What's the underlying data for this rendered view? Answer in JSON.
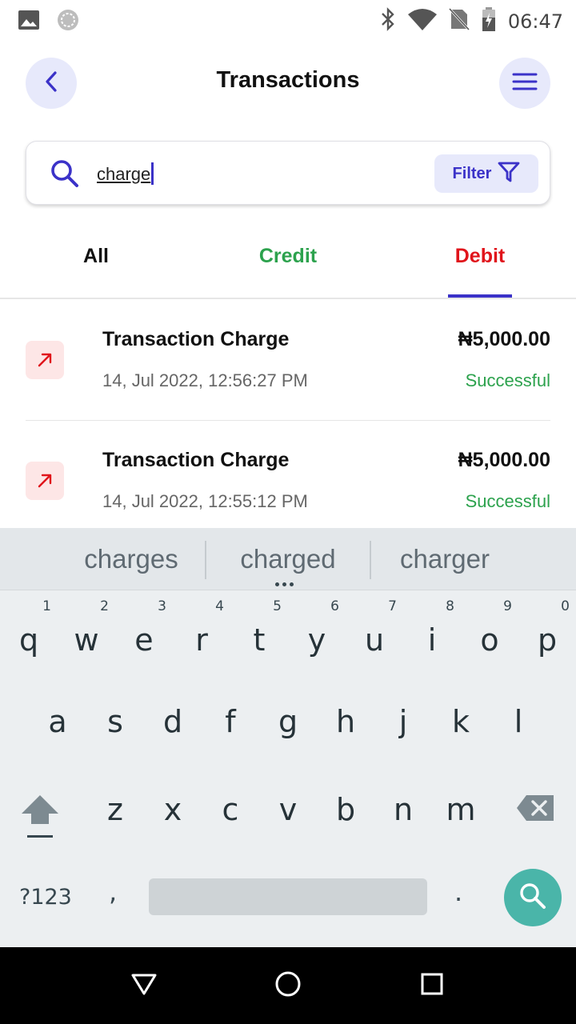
{
  "status_bar": {
    "time": "06:47",
    "icons": [
      "image-icon",
      "sync-icon",
      "bluetooth-icon",
      "wifi-icon",
      "no-sim-icon",
      "battery-icon"
    ]
  },
  "header": {
    "title": "Transactions",
    "back_icon": "chevron-left-icon",
    "menu_icon": "hamburger-menu-icon"
  },
  "search": {
    "value": "charge",
    "filter_label": "Filter"
  },
  "tabs": [
    {
      "label": "All",
      "color": "#111111"
    },
    {
      "label": "Credit",
      "color": "#2ca24d"
    },
    {
      "label": "Debit",
      "color": "#e0141b",
      "selected": true
    }
  ],
  "transactions": [
    {
      "title": "Transaction Charge",
      "date": "14, Jul 2022, 12:56:27 PM",
      "amount": "₦5,000.00",
      "status": "Successful",
      "type": "debit"
    },
    {
      "title": "Transaction Charge",
      "date": "14, Jul 2022, 12:55:12 PM",
      "amount": "₦5,000.00",
      "status": "Successful",
      "type": "debit"
    }
  ],
  "keyboard": {
    "suggestions": [
      "charges",
      "charged",
      "charger"
    ],
    "row1": [
      {
        "hint": "1",
        "key": "q"
      },
      {
        "hint": "2",
        "key": "w"
      },
      {
        "hint": "3",
        "key": "e"
      },
      {
        "hint": "4",
        "key": "r"
      },
      {
        "hint": "5",
        "key": "t"
      },
      {
        "hint": "6",
        "key": "y"
      },
      {
        "hint": "7",
        "key": "u"
      },
      {
        "hint": "8",
        "key": "i"
      },
      {
        "hint": "9",
        "key": "o"
      },
      {
        "hint": "0",
        "key": "p"
      }
    ],
    "row2": [
      "a",
      "s",
      "d",
      "f",
      "g",
      "h",
      "j",
      "k",
      "l"
    ],
    "row3": [
      "z",
      "x",
      "c",
      "v",
      "b",
      "n",
      "m"
    ],
    "symbols_label": "?123",
    "comma": ",",
    "period": "."
  },
  "colors": {
    "accent": "#3b32c8",
    "credit": "#2ca24d",
    "debit": "#e0141b",
    "keyboard_action": "#4ab5a9"
  }
}
